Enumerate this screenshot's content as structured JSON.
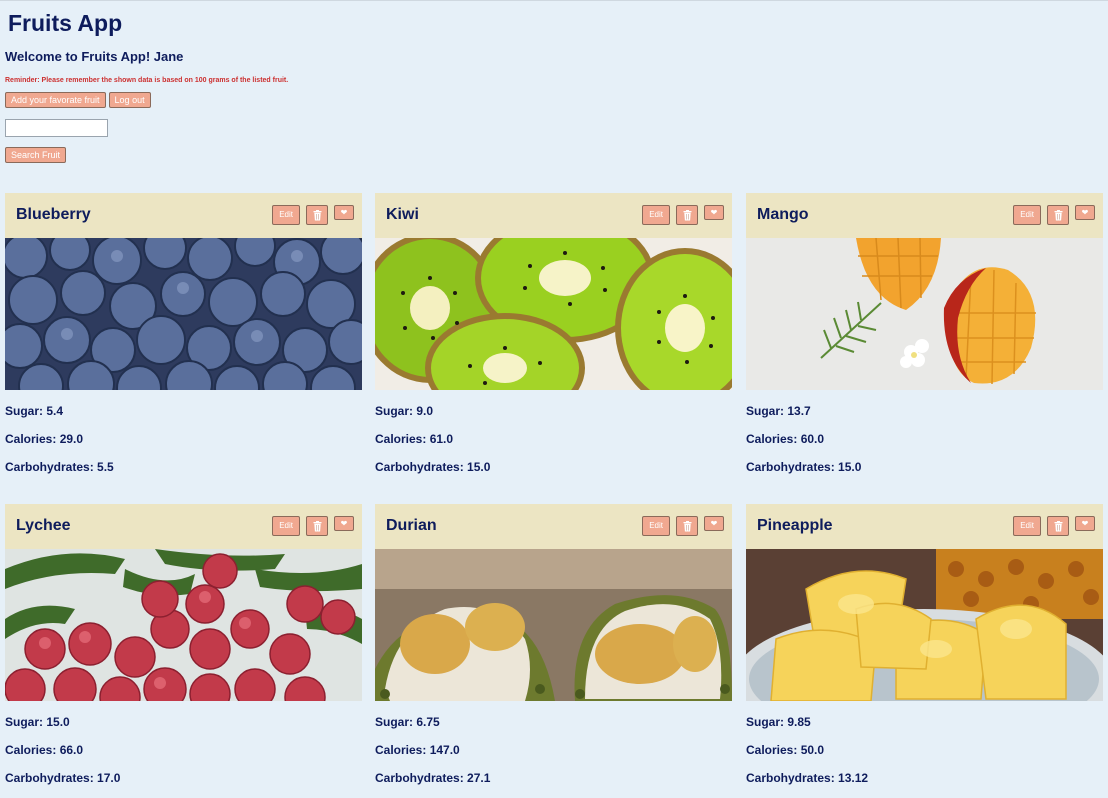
{
  "app": {
    "title": "Fruits App",
    "welcome": "Welcome to Fruits App! Jane",
    "reminder": "Reminder: Please remember the shown data is based on 100 grams of the listed fruit.",
    "add_button": "Add your favorate fruit",
    "logout_button": "Log out",
    "search_value": "",
    "search_button": "Search Fruit"
  },
  "card_labels": {
    "edit": "Edit",
    "sugar": "Sugar: ",
    "calories": "Calories: ",
    "carbs": "Carbohydrates: "
  },
  "fruits": [
    {
      "name": "Blueberry",
      "sugar": "5.4",
      "calories": "29.0",
      "carbs": "5.5"
    },
    {
      "name": "Kiwi",
      "sugar": "9.0",
      "calories": "61.0",
      "carbs": "15.0"
    },
    {
      "name": "Mango",
      "sugar": "13.7",
      "calories": "60.0",
      "carbs": "15.0"
    },
    {
      "name": "Lychee",
      "sugar": "15.0",
      "calories": "66.0",
      "carbs": "17.0"
    },
    {
      "name": "Durian",
      "sugar": "6.75",
      "calories": "147.0",
      "carbs": "27.1"
    },
    {
      "name": "Pineapple",
      "sugar": "9.85",
      "calories": "50.0",
      "carbs": "13.12"
    }
  ],
  "colors": {
    "background": "#e6f0f8",
    "card_header": "#ece5c3",
    "button": "#f0a890",
    "title_text": "#0e1c5c",
    "reminder_text": "#cc3030"
  },
  "icons": {
    "delete": "trash-icon",
    "favorite": "heart-icon"
  }
}
